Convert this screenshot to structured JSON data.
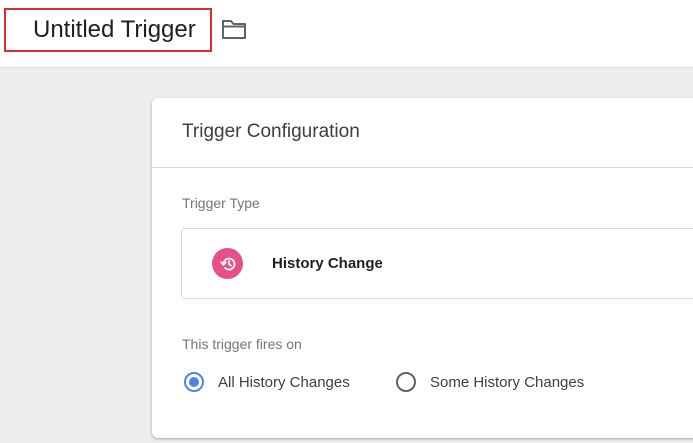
{
  "header": {
    "title": "Untitled Trigger",
    "folder_icon": "folder-icon"
  },
  "card": {
    "title": "Trigger Configuration",
    "trigger_type_label": "Trigger Type",
    "trigger_type": {
      "name": "History Change",
      "icon": "history-icon",
      "icon_color": "#e5508a"
    },
    "fires_on_label": "This trigger fires on",
    "fires_on_options": [
      {
        "label": "All History Changes",
        "selected": true
      },
      {
        "label": "Some History Changes",
        "selected": false
      }
    ]
  },
  "colors": {
    "accent": "#4a86e8",
    "highlight_border": "#d32f2f"
  }
}
